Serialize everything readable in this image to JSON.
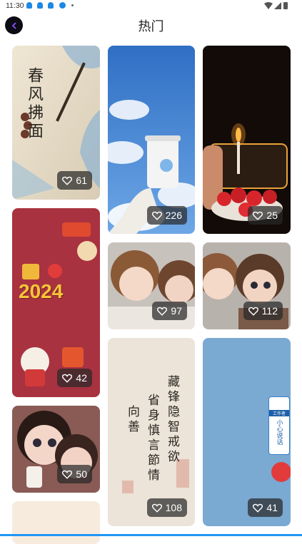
{
  "status_bar": {
    "time": "11:30"
  },
  "header": {
    "title": "热门"
  },
  "cards": [
    {
      "likes": "61",
      "art_text": "春风拂面"
    },
    {
      "likes": "42",
      "art_text": "2024"
    },
    {
      "likes": "50"
    },
    {
      "likes": "226"
    },
    {
      "likes": "97"
    },
    {
      "likes": "108",
      "art_text_lines": [
        "藏锋隐智戒欲",
        "省身慎言節情",
        "向善"
      ]
    },
    {
      "likes": "25"
    },
    {
      "likes": "112"
    },
    {
      "likes": "41",
      "badge_text": "工作者",
      "sign_text": "小心说话"
    }
  ]
}
